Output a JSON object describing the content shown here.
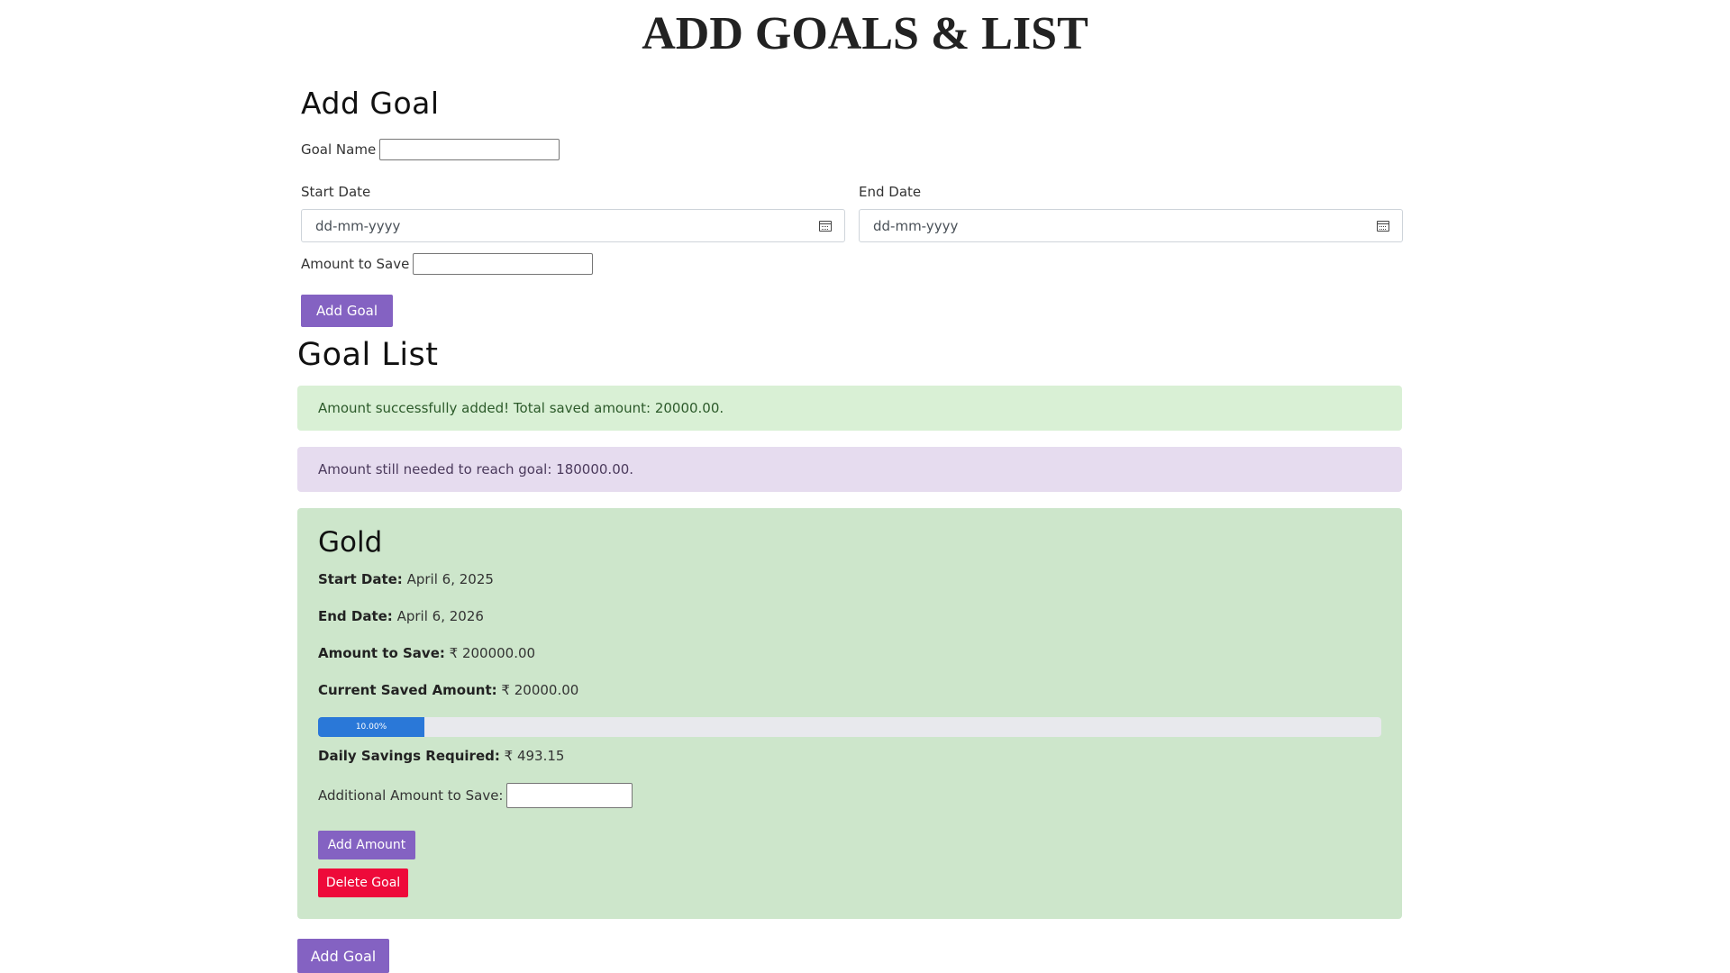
{
  "page": {
    "title": "ADD GOALS & LIST"
  },
  "add_goal": {
    "heading": "Add Goal",
    "goal_name_label": "Goal Name",
    "goal_name_value": "",
    "start_date_label": "Start Date",
    "start_date_placeholder": "dd-mm-yyyy",
    "end_date_label": "End Date",
    "end_date_placeholder": "dd-mm-yyyy",
    "amount_label": "Amount to Save",
    "amount_value": "",
    "submit_label": "Add Goal"
  },
  "goal_list": {
    "heading": "Goal List",
    "success_message": "Amount successfully added! Total saved amount: 20000.00.",
    "remaining_message": "Amount still needed to reach goal: 180000.00.",
    "goals": [
      {
        "name": "Gold",
        "start_date_label": "Start Date:",
        "start_date": "April 6, 2025",
        "end_date_label": "End Date:",
        "end_date": "April 6, 2026",
        "amount_label": "Amount to Save:",
        "amount": "₹ 200000.00",
        "current_label": "Current Saved Amount:",
        "current": "₹ 20000.00",
        "progress_percent": 10,
        "progress_label": "10.00%",
        "daily_label": "Daily Savings Required:",
        "daily": "₹ 493.15",
        "additional_label": "Additional Amount to Save:",
        "additional_value": "",
        "add_amount_label": "Add Amount",
        "delete_label": "Delete Goal"
      }
    ],
    "add_goal_button": "Add Goal"
  },
  "colors": {
    "primary_button": "#8462c2",
    "danger_button": "#ee0a3a",
    "success_alert": "#d9f0d5",
    "info_alert": "#e6dcef",
    "goal_card": "#cde6cb",
    "progress_fill": "#2a78d8"
  },
  "icons": {
    "date_picker": "calendar-icon"
  }
}
